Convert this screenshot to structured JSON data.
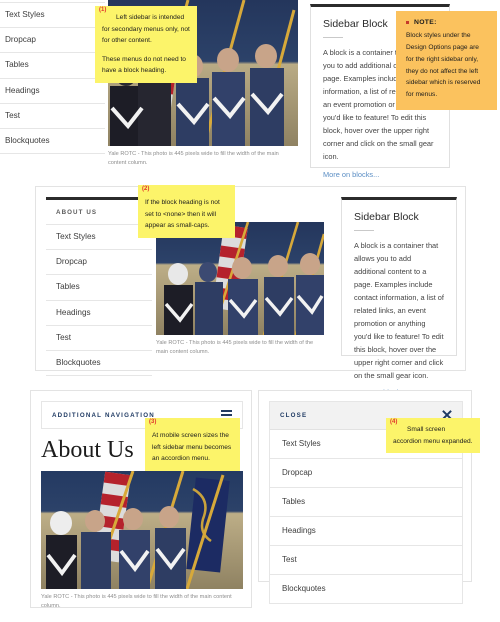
{
  "menu": {
    "heading": "ABOUT US",
    "items": [
      "Text Styles",
      "Dropcap",
      "Tables",
      "Headings",
      "Test",
      "Blockquotes"
    ]
  },
  "sidebar_block": {
    "title": "Sidebar Block",
    "body": "A block is a container that allows you to add additional content to a page. Examples include contact information, a list of related links, an event promotion or anything you'd like to feature! To edit this block, hover over the upper right corner and click on the small gear icon.",
    "link": "More on blocks..."
  },
  "photo": {
    "caption": "Yale ROTC - This photo is 445 pixels wide to fill the width of the main content column."
  },
  "note": {
    "title": "NOTE:",
    "body": "Block styles under the Design Options page are for the right sidebar only, they do not affect the left sidebar which is reserved for menus."
  },
  "annotations": {
    "one": {
      "marker": "(1)",
      "line1": "Left sidebar is intended for secondary menus only, not for other content.",
      "line2": "These menus do not need to have a block heading."
    },
    "two": {
      "marker": "(2)",
      "text": "If the block heading is not set to <none> then it will appear as small-caps."
    },
    "three": {
      "marker": "(3)",
      "text": "At mobile screen sizes the left sidebar menu becomes an accordion menu."
    },
    "four": {
      "marker": "(4)",
      "text": "Small screen accordion menu expanded."
    }
  },
  "mobile": {
    "nav_label": "ADDITIONAL NAVIGATION",
    "page_title": "About Us",
    "close_label": "CLOSE",
    "items": [
      "Text Styles",
      "Dropcap",
      "Tables",
      "Headings",
      "Test",
      "Blockquotes"
    ]
  },
  "colors": {
    "annotation_bg": "#fcf46a",
    "note_bg": "#fbc25e",
    "marker": "#e0342a",
    "link": "#5b8ec4",
    "navy": "#1f3a63"
  }
}
